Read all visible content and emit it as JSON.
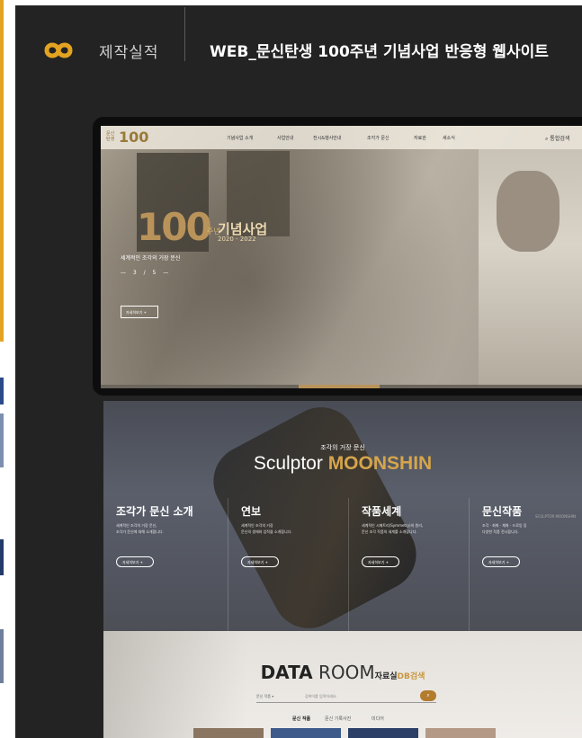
{
  "header": {
    "category": "제작실적",
    "title": "WEB_문신탄생 100주년 기념사업 반응형 웹사이트"
  },
  "colors": {
    "accent": "#e3a321",
    "panel": "#232323",
    "gold": "#c9973e"
  },
  "preview": {
    "logo_small": "문신\n탄생",
    "logo_num": "100",
    "nav": [
      "기념사업 소개",
      "사업안내",
      "전시&행사안내",
      "조각가 문신",
      "자료관",
      "새소식"
    ],
    "search": "통합검색",
    "hero": {
      "number": "100",
      "jn": "주년",
      "title": "기념사업",
      "years": "2020 - 2022",
      "subtitle": "세계적인 조각의 거장 문신",
      "pager": "— 3 / 5 —",
      "button": "자세히보기 +"
    }
  },
  "sculptor": {
    "kicker": "조각의 거장 문신",
    "title_prefix": "Sculptor ",
    "title_name": "MOONSHIN",
    "columns": [
      {
        "heading": "조각가 문신 소개",
        "desc": "세계적인 조각의 거장 문신,\n조각가 문신에 대해 소개합니다.",
        "button": "자세히보기 +"
      },
      {
        "heading": "연보",
        "desc": "세계적인 조각의 거장\n문신의 생애와 업적을 소개합니다.",
        "button": "자세히보기 +"
      },
      {
        "heading": "작품세계",
        "desc": "세계적인 시메트리(Symmetry)의 원리,\n문신 조각 작품의 세계를 소개합니다.",
        "button": "자세히보기 +"
      },
      {
        "heading": "문신작품",
        "desc": "조각 · 회화 · 채화 · 드로잉 등\n다양한 작품 전시합니다.",
        "button": "자세히보기 +"
      }
    ],
    "side_label": "SCULPTOR MOONSHIN"
  },
  "dataroom": {
    "title_bold": "DATA",
    "title_light": " ROOM",
    "title_kr": "자료실",
    "title_db": "DB검색",
    "select": "문신 작품",
    "placeholder": "검색어를 입력하세요.",
    "tabs": [
      "문신 작품",
      "문신 기록사진",
      "미디어"
    ]
  }
}
